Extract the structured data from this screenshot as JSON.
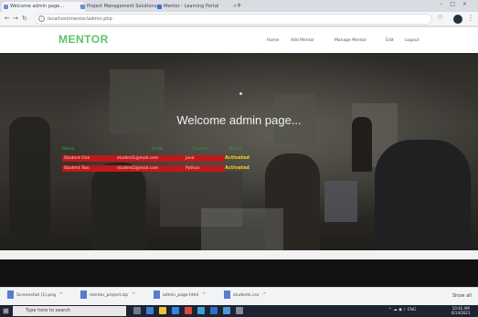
{
  "browser": {
    "tabs": [
      {
        "label": "Welcome admin page…"
      },
      {
        "label": "Project Management Solutions…"
      },
      {
        "label": "Mentor - Learning Portal"
      }
    ],
    "new_tab": "+",
    "url": "localhost/mentor/admin.php",
    "icons": [
      "back-icon",
      "forward-icon",
      "reload-icon",
      "home-icon",
      "info-icon",
      "bookmark-star-icon",
      "profile-icon",
      "menu-icon"
    ]
  },
  "site": {
    "logo": "MENTOR",
    "nav": [
      "Home",
      "Add Mentor",
      "Manage Mentor",
      "Edit",
      "Logout"
    ]
  },
  "hero": {
    "title": "Welcome admin page...",
    "table": {
      "headers": [
        "Name",
        "Email",
        "Course",
        "Status"
      ],
      "rows": [
        {
          "name": "Student One",
          "email": "student1@mail.com",
          "course": "Java",
          "status": "Activated"
        },
        {
          "name": "Student Two",
          "email": "student2@mail.com",
          "course": "Python",
          "status": "Activated"
        }
      ]
    }
  },
  "downloads": {
    "items": [
      {
        "name": "Screenshot (1).png"
      },
      {
        "name": "mentor_project.zip"
      },
      {
        "name": "admin_page.html"
      },
      {
        "name": "students.csv"
      }
    ],
    "show_all": "Show all"
  },
  "taskbar": {
    "search_placeholder": "Type here to search",
    "time": "10:42 AM",
    "date": "6/14/2021",
    "tray_text": "ENG"
  },
  "colors": {
    "logo_green": "#5dc36a",
    "row_red": "#c01818",
    "status_yellow": "#f3d11f"
  }
}
